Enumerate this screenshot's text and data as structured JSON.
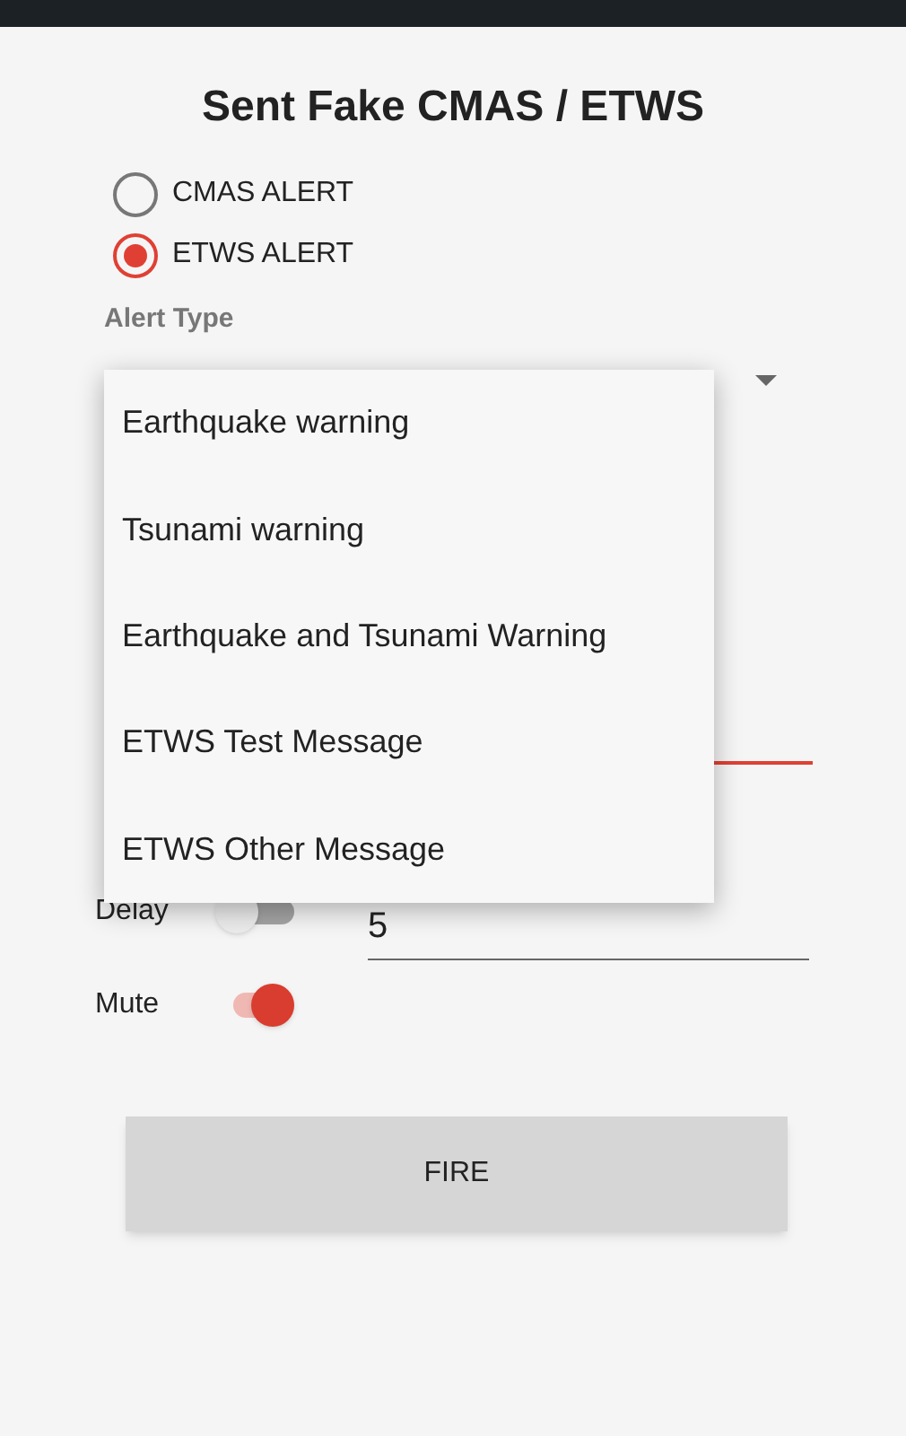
{
  "title": "Sent Fake CMAS / ETWS",
  "radios": [
    {
      "label": "CMAS ALERT",
      "selected": false
    },
    {
      "label": "ETWS ALERT",
      "selected": true
    }
  ],
  "alert_type_label": "Alert Type",
  "menu_items": [
    "Earthquake warning",
    "Tsunami warning",
    "Earthquake and Tsunami Warning",
    "ETWS Test Message",
    "ETWS Other Message"
  ],
  "switches": [
    {
      "label": "Delay",
      "on": false,
      "value": "5"
    },
    {
      "label": "Mute",
      "on": true
    }
  ],
  "fire_button": "FIRE"
}
